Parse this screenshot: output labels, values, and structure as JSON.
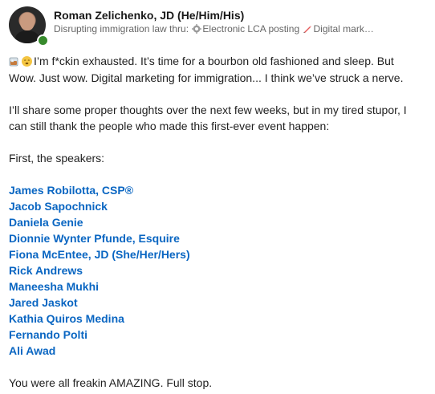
{
  "author": {
    "name": "Roman Zelichenko, JD (He/Him/His)",
    "headline_prefix": "Disrupting immigration law thru: ",
    "headline_middle": "Electronic LCA posting ",
    "headline_suffix": "Digital mark…",
    "status_color": "#378a2c"
  },
  "post": {
    "line_1": "I’m f*ckin exhausted. It’s time for a bourbon old fashioned and sleep. But",
    "line_2": "Wow. Just wow. Digital marketing for immigration... I think we’ve struck a nerve.",
    "line_3": "I’ll share some proper thoughts over the next few weeks, but in my tired stupor, I",
    "line_4": "can still thank the people who made this first-ever event happen:",
    "line_5": "First, the speakers:",
    "closing": "You were all freakin AMAZING. Full stop."
  },
  "speakers": [
    "James Robilotta, CSP®",
    "Jacob Sapochnick",
    "Daniela Genie",
    "Dionnie Wynter Pfunde, Esquire",
    "Fiona McEntee, JD (She/Her/Hers)",
    "Rick Andrews",
    "Maneesha Mukhi",
    "Jared Jaskot",
    "Kathia Quiros Medina",
    "Fernando Polti",
    "Ali Awad"
  ],
  "colors": {
    "link": "#0a66c2",
    "text": "#1f1f1f",
    "muted": "#666666"
  },
  "icons": {
    "headline_gear": "gear-icon",
    "headline_pencil": "pencil-icon",
    "emoji_drink": "whiskey-icon",
    "emoji_face": "face-icon"
  }
}
